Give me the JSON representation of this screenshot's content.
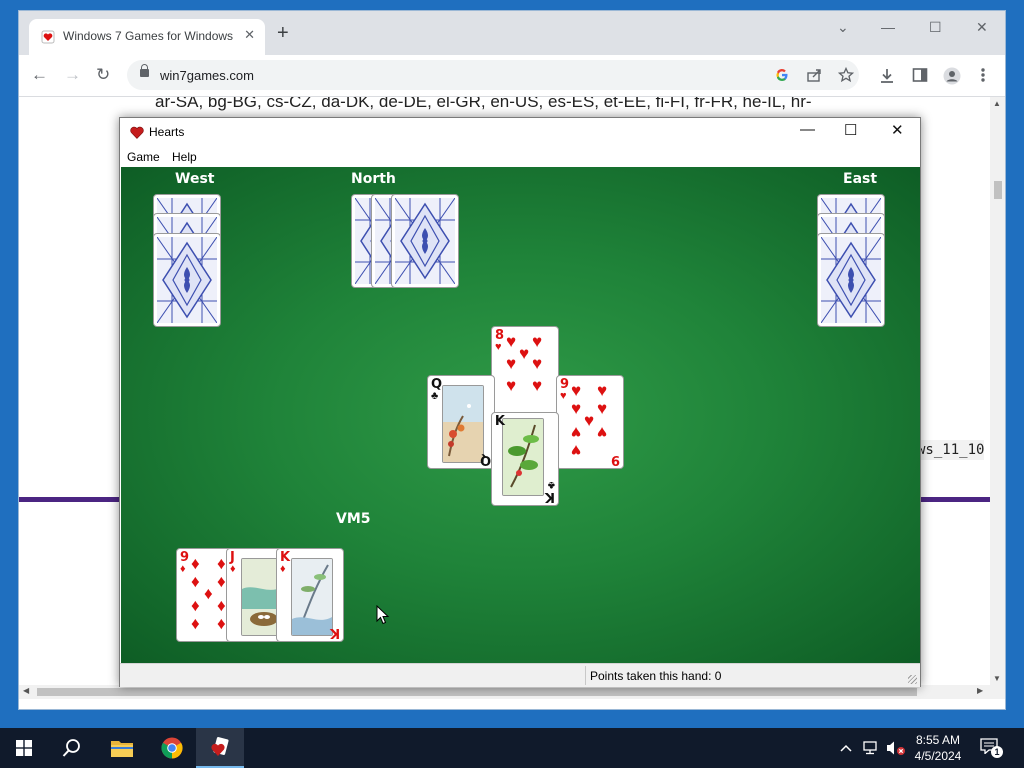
{
  "browser": {
    "tab_title": "Windows 7 Games for Windows",
    "tab_close": "✕",
    "new_tab": "+",
    "url": "win7games.com",
    "window_controls": {
      "dropdown": "⌄",
      "minimize": "—",
      "maximize": "☐",
      "close": "✕"
    },
    "nav": {
      "back": "←",
      "forward": "→",
      "reload": "↻"
    },
    "page_text": {
      "languages_line": "ar-SA, bg-BG, cs-CZ, da-DK, de-DE, el-GR, en-US, es-ES, et-EE, fi-FI, fr-FR, he-IL, hr-",
      "code_fragment": "ws_11_10"
    }
  },
  "hearts": {
    "window_title": "Hearts",
    "controls": {
      "minimize": "—",
      "maximize": "☐",
      "close": "✕"
    },
    "menu": [
      "Game",
      "Help"
    ],
    "players": {
      "west": "West",
      "north": "North",
      "east": "East",
      "south": "VM5"
    },
    "hand_counts": {
      "west": 3,
      "north": 3,
      "east": 3,
      "south": 3
    },
    "trick": [
      {
        "position": "north",
        "rank": "8",
        "suit": "♥",
        "color": "#d11"
      },
      {
        "position": "west",
        "rank": "Q",
        "suit": "♣",
        "color": "#111"
      },
      {
        "position": "east",
        "rank": "9",
        "suit": "♥",
        "color": "#d11"
      },
      {
        "position": "south",
        "rank": "K",
        "suit": "♣",
        "color": "#111"
      }
    ],
    "south_hand": [
      {
        "rank": "9",
        "suit": "♦",
        "color": "#d11"
      },
      {
        "rank": "J",
        "suit": "♦",
        "color": "#d11"
      },
      {
        "rank": "K",
        "suit": "♦",
        "color": "#d11"
      }
    ],
    "status": "Points taken this hand: 0"
  },
  "taskbar": {
    "time": "8:55 AM",
    "date": "4/5/2024",
    "notification_count": "1",
    "pinned": [
      "start",
      "search",
      "file-explorer",
      "chrome",
      "hearts"
    ]
  },
  "colors": {
    "felt": "#1f8339",
    "heart_red": "#d11",
    "card_back_blue": "#3d4fb0",
    "taskbar": "#101a2b"
  }
}
